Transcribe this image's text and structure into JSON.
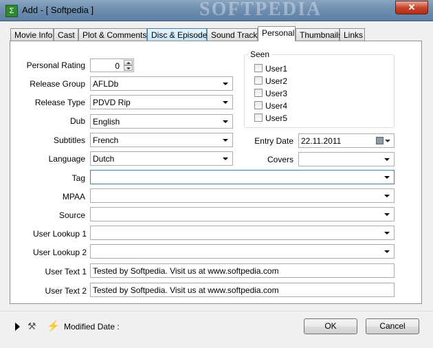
{
  "window": {
    "title": "Add - [ Softpedia ]",
    "watermark": "SOFTPEDIA",
    "close_label": "✕"
  },
  "tabs": [
    {
      "label": "Movie Info"
    },
    {
      "label": "Cast"
    },
    {
      "label": "Plot & Comments"
    },
    {
      "label": "Disc & Episodes"
    },
    {
      "label": "Sound Tracks"
    },
    {
      "label": "Personal"
    },
    {
      "label": "Thumbnails"
    },
    {
      "label": "Links"
    }
  ],
  "form": {
    "personal_rating": {
      "label": "Personal Rating",
      "value": "0"
    },
    "release_group": {
      "label": "Release Group",
      "value": "AFLDb"
    },
    "release_type": {
      "label": "Release Type",
      "value": "PDVD Rip"
    },
    "dub": {
      "label": "Dub",
      "value": "English"
    },
    "subtitles": {
      "label": "Subtitles",
      "value": "French"
    },
    "language": {
      "label": "Language",
      "value": "Dutch"
    },
    "tag": {
      "label": "Tag",
      "value": ""
    },
    "mpaa": {
      "label": "MPAA",
      "value": ""
    },
    "source": {
      "label": "Source",
      "value": ""
    },
    "user_lookup_1": {
      "label": "User Lookup 1",
      "value": ""
    },
    "user_lookup_2": {
      "label": "User Lookup 2",
      "value": ""
    },
    "user_text_1": {
      "label": "User Text 1",
      "value": "Tested by Softpedia. Visit us at www.softpedia.com"
    },
    "user_text_2": {
      "label": "User Text 2",
      "value": "Tested by Softpedia. Visit us at www.softpedia.com"
    },
    "entry_date": {
      "label": "Entry Date",
      "value": "22.11.2011"
    },
    "covers": {
      "label": "Covers",
      "value": ""
    }
  },
  "seen": {
    "legend": "Seen",
    "users": [
      {
        "label": "User1",
        "checked": false
      },
      {
        "label": "User2",
        "checked": false
      },
      {
        "label": "User3",
        "checked": false
      },
      {
        "label": "User4",
        "checked": false
      },
      {
        "label": "User5",
        "checked": false
      }
    ]
  },
  "footer": {
    "modified_label": "Modified Date :",
    "ok_label": "OK",
    "cancel_label": "Cancel"
  }
}
